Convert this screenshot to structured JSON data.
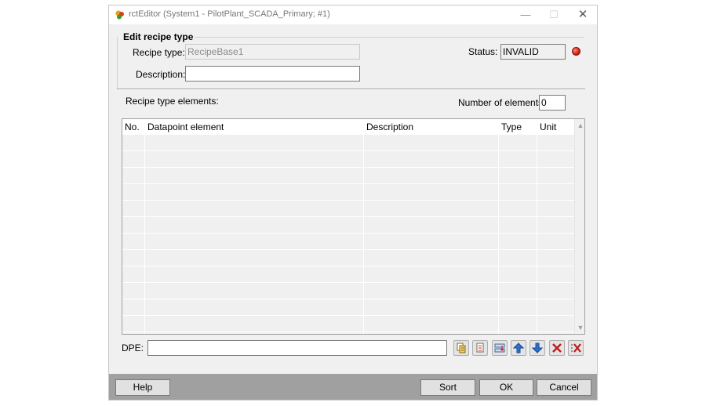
{
  "window": {
    "title": "rctEditor (System1 - PilotPlant_SCADA_Primary; #1)",
    "controls": {
      "minimize": "—",
      "maximize": "☐",
      "close": "✕"
    }
  },
  "group": {
    "title": "Edit recipe type"
  },
  "form": {
    "recipe_type_label": "Recipe type:",
    "recipe_type_value": "RecipeBase1",
    "description_label": "Description:",
    "description_value": "",
    "status_label": "Status:",
    "status_value": "INVALID",
    "status_color": "#d41c10"
  },
  "elements": {
    "label": "Recipe type elements:",
    "count_label": "Number of elements:",
    "count_value": "0"
  },
  "table": {
    "columns": [
      "No.",
      "Datapoint element",
      "Description",
      "Type",
      "Unit"
    ],
    "rows": []
  },
  "dpe": {
    "label": "DPE:",
    "value": ""
  },
  "toolbar_icons": [
    "dp-browse-icon",
    "dp-select-icon",
    "swap-icon",
    "move-up-icon",
    "move-down-icon",
    "delete-icon",
    "delete-all-icon"
  ],
  "buttons": {
    "help": "Help",
    "sort": "Sort",
    "ok": "OK",
    "cancel": "Cancel"
  }
}
